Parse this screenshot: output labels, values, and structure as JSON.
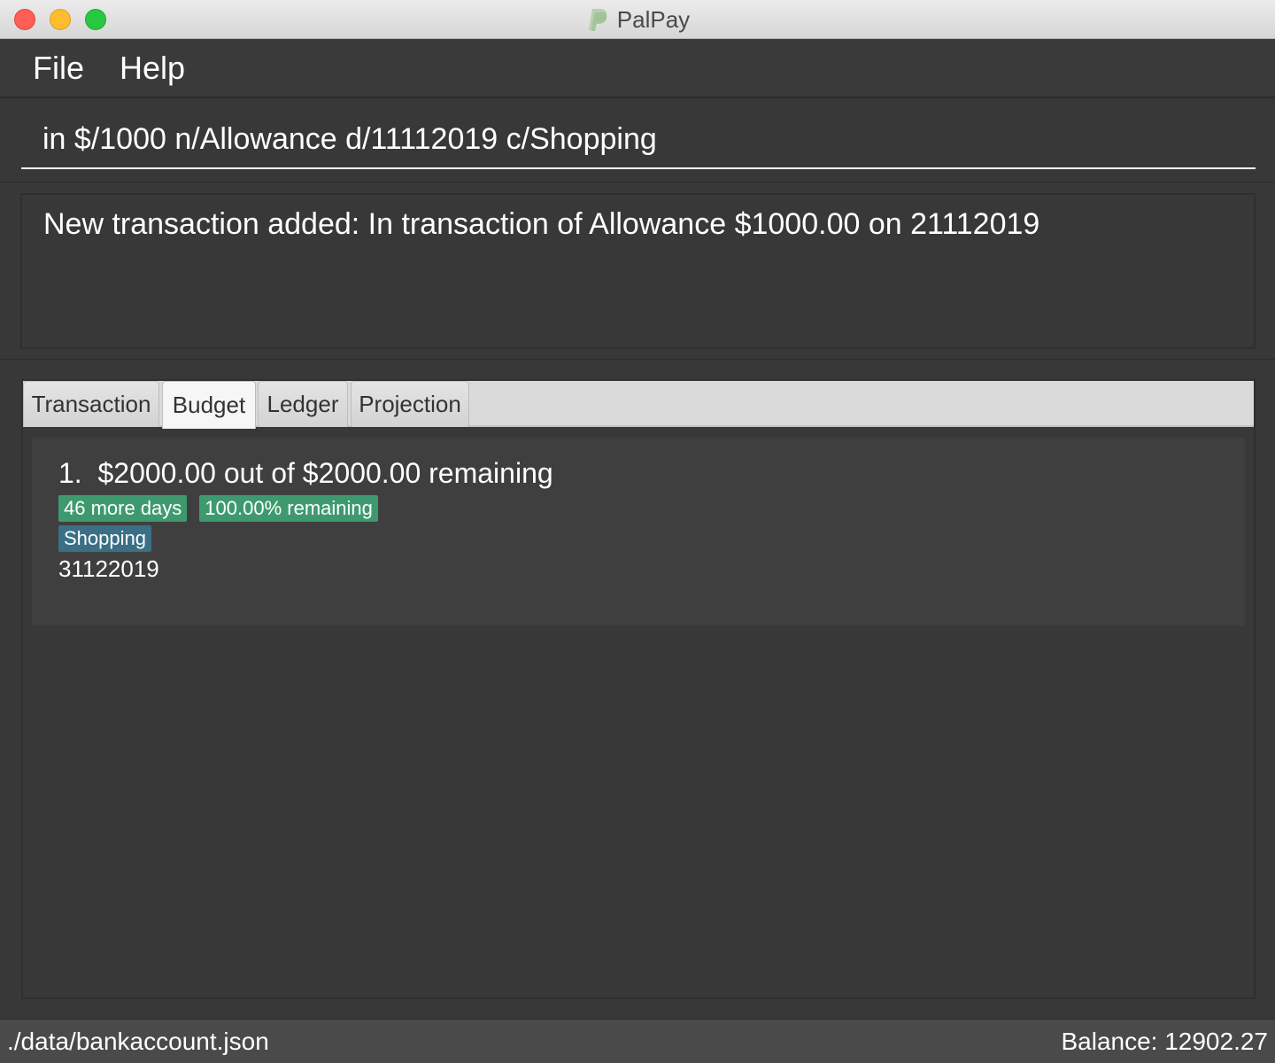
{
  "window": {
    "title": "PalPay"
  },
  "menu": {
    "items": [
      "File",
      "Help"
    ]
  },
  "command": {
    "value": "in $/1000 n/Allowance d/11112019 c/Shopping"
  },
  "result": {
    "text": "New transaction added: In transaction of Allowance $1000.00 on 21112019"
  },
  "tabs": {
    "labels": [
      "Transaction",
      "Budget",
      "Ledger",
      "Projection"
    ],
    "active": "Budget"
  },
  "budget": {
    "items": [
      {
        "index": "1.",
        "summary": "$2000.00 out of $2000.00 remaining",
        "days_tag": "46 more days",
        "percent_tag": "100.00% remaining",
        "category": "Shopping",
        "deadline": "31122019"
      }
    ]
  },
  "status": {
    "file_path": "./data/bankaccount.json",
    "balance": "Balance: 12902.27"
  },
  "colors": {
    "tag_green": "#3e9a6e",
    "tag_blue": "#3a6f85",
    "background": "#383838"
  },
  "icons": {
    "app": "palpay-logo-icon"
  }
}
